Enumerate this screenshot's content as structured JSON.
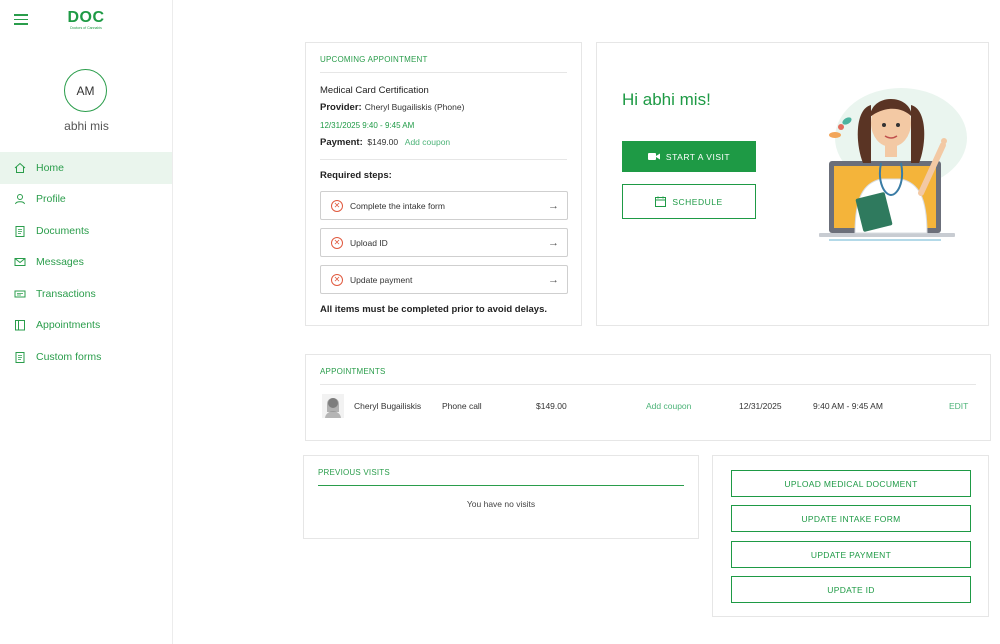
{
  "brand": {
    "logo_text": "DOC",
    "logo_subtext": "Doctors of Cannabis",
    "accent": "#1e9a45",
    "error": "#e05a3f"
  },
  "user": {
    "initials": "AM",
    "name": "abhi mis"
  },
  "sidebar": {
    "items": [
      {
        "label": "Home",
        "icon": "home-icon",
        "active": true
      },
      {
        "label": "Profile",
        "icon": "user-icon"
      },
      {
        "label": "Documents",
        "icon": "clipboard-icon"
      },
      {
        "label": "Messages",
        "icon": "mail-icon"
      },
      {
        "label": "Transactions",
        "icon": "money-icon"
      },
      {
        "label": "Appointments",
        "icon": "book-icon"
      },
      {
        "label": "Custom forms",
        "icon": "clipboard-icon"
      }
    ]
  },
  "upcoming": {
    "section_label": "UPCOMING APPOINTMENT",
    "title": "Medical Card Certification",
    "provider_label": "Provider:",
    "provider_value": "Cheryl Bugailiskis (Phone)",
    "datetime": "12/31/2025 9:40 - 9:45 AM",
    "payment_label": "Payment:",
    "payment_value": "$149.00",
    "add_coupon": "Add coupon",
    "required_title": "Required steps:",
    "steps": [
      {
        "label": "Complete the intake form"
      },
      {
        "label": "Upload ID"
      },
      {
        "label": "Update payment"
      }
    ],
    "note": "All items must be completed prior to avoid delays."
  },
  "welcome": {
    "greeting": "Hi abhi mis!",
    "start_visit": "START A VISIT",
    "schedule": "SCHEDULE"
  },
  "appointments": {
    "section_label": "APPOINTMENTS",
    "rows": [
      {
        "name": "Cheryl Bugailiskis",
        "type": "Phone call",
        "price": "$149.00",
        "coupon": "Add coupon",
        "date": "12/31/2025",
        "time": "9:40 AM - 9:45 AM",
        "edit": "EDIT"
      }
    ]
  },
  "previous": {
    "section_label": "PREVIOUS VISITS",
    "empty": "You have no visits"
  },
  "actions": {
    "buttons": [
      {
        "label": "UPLOAD MEDICAL DOCUMENT"
      },
      {
        "label": "UPDATE INTAKE FORM"
      },
      {
        "label": "UPDATE PAYMENT"
      },
      {
        "label": "UPDATE ID"
      }
    ]
  }
}
